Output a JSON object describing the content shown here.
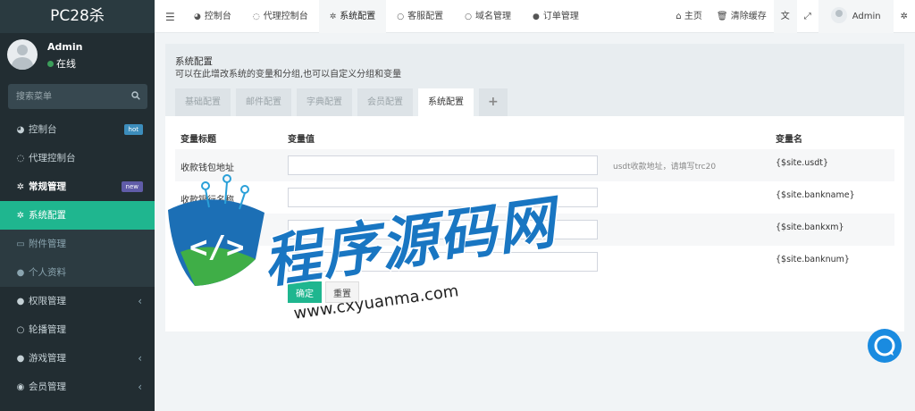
{
  "sidebar": {
    "logo": "PC28杀",
    "user": {
      "name": "Admin",
      "status": "在线"
    },
    "search": {
      "placeholder": "搜索菜单"
    },
    "items": [
      {
        "label": "控制台",
        "icon": "dashboard-icon",
        "glyph": "◕",
        "badge": "hot"
      },
      {
        "label": "代理控制台",
        "icon": "agent-icon",
        "glyph": "◌"
      },
      {
        "label": "常规管理",
        "icon": "cogs-icon",
        "glyph": "✲",
        "badge": "new"
      },
      {
        "label": "系统配置",
        "icon": "gear-icon",
        "glyph": "✲"
      },
      {
        "label": "附件管理",
        "icon": "file-icon",
        "glyph": "▭"
      },
      {
        "label": "个人资料",
        "icon": "user-icon",
        "glyph": "●"
      },
      {
        "label": "权限管理",
        "icon": "group-icon",
        "glyph": "●"
      },
      {
        "label": "轮播管理",
        "icon": "circle-icon",
        "glyph": "○"
      },
      {
        "label": "游戏管理",
        "icon": "bomb-icon",
        "glyph": "●"
      },
      {
        "label": "会员管理",
        "icon": "user-circle-icon",
        "glyph": "◉"
      },
      {
        "label": "...",
        "icon": "more-icon",
        "glyph": ""
      }
    ]
  },
  "topbar": {
    "tabs": [
      {
        "label": "控制台",
        "icon": "dashboard-icon",
        "glyph": "◕"
      },
      {
        "label": "代理控制台",
        "icon": "agent-icon",
        "glyph": "◌"
      },
      {
        "label": "系统配置",
        "icon": "gear-icon",
        "glyph": "✲"
      },
      {
        "label": "客服配置",
        "icon": "circle-icon",
        "glyph": "○"
      },
      {
        "label": "域名管理",
        "icon": "circle-icon",
        "glyph": "○"
      },
      {
        "label": "订单管理",
        "icon": "bomb-icon",
        "glyph": "●"
      }
    ],
    "right": {
      "home": "主页",
      "clear_cache": "清除缓存",
      "admin": "Admin"
    }
  },
  "config": {
    "title": "系统配置",
    "description": "可以在此增改系统的变量和分组,也可以自定义分组和变量",
    "tabs": [
      "基础配置",
      "邮件配置",
      "字典配置",
      "会员配置",
      "系统配置"
    ],
    "add_tab": "+",
    "table": {
      "headers": [
        "变量标题",
        "变量值",
        "变量名"
      ],
      "rows": [
        {
          "label": "收款钱包地址",
          "value": "",
          "hint": "usdt收款地址，请填写trc20",
          "var": "{$site.usdt}"
        },
        {
          "label": "收款银行名称",
          "value": "",
          "hint": "",
          "var": "{$site.bankname}"
        },
        {
          "label": "",
          "value": "",
          "hint": "",
          "var": "{$site.bankxm}"
        },
        {
          "label": "",
          "value": "",
          "hint": "",
          "var": "{$site.banknum}"
        }
      ]
    },
    "submit": "确定",
    "reset": "重置"
  },
  "watermark": {
    "text": "程序源码网",
    "url": "www.cxyuanma.com"
  },
  "colors": {
    "sidebar": "#222d32",
    "accent": "#1fb68f",
    "hot": "#3c8dbc",
    "new": "#605ca8",
    "watermark": "#1976c2"
  }
}
